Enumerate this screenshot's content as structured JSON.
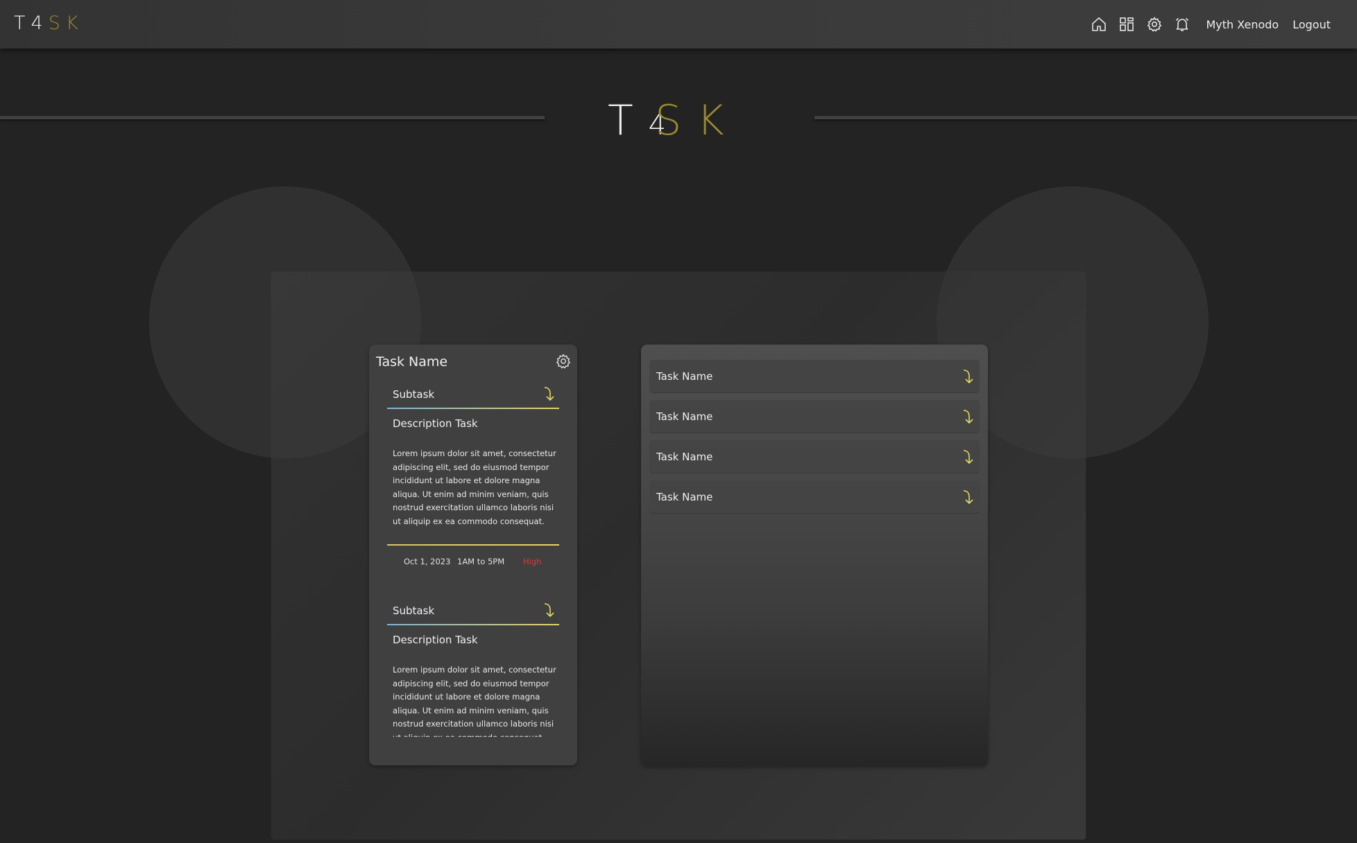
{
  "app": {
    "logo": {
      "t": "T",
      "four": "4",
      "rest": "SK"
    },
    "nav": {
      "icons": [
        "home-icon",
        "grid-icon",
        "gear-icon",
        "alarm-icon"
      ],
      "user_name": "Myth Xenodo",
      "logout_label": "Logout"
    }
  },
  "hero": {
    "t": "T",
    "four": "4",
    "rest": "SK"
  },
  "task_card": {
    "title": "Task Name",
    "subtasks": [
      {
        "label": "Subtask",
        "description_title": "Description Task",
        "description": "Lorem ipsum dolor sit amet, consectetur adipiscing elit, sed do eiusmod tempor incididunt ut labore et dolore magna aliqua. Ut enim ad minim veniam, quis nostrud exercitation ullamco laboris nisi ut aliquip ex ea commodo consequat.",
        "date": "Oct 1, 2023",
        "time": "1AM to 5PM",
        "priority": "High"
      },
      {
        "label": "Subtask",
        "description_title": "Description Task",
        "description": "Lorem ipsum dolor sit amet, consectetur adipiscing elit, sed do eiusmod tempor incididunt ut labore et dolore magna aliqua. Ut enim ad minim veniam, quis nostrud exercitation ullamco laboris nisi ut aliquip ex ea commodo consequat."
      }
    ]
  },
  "task_list": {
    "items": [
      {
        "label": "Task Name"
      },
      {
        "label": "Task Name"
      },
      {
        "label": "Task Name"
      },
      {
        "label": "Task Name"
      }
    ]
  },
  "colors": {
    "background": "#232323",
    "accent_gold": "#9c8a32",
    "arrow_yellow": "#e7dc5c",
    "priority_high": "#d63b3b"
  }
}
